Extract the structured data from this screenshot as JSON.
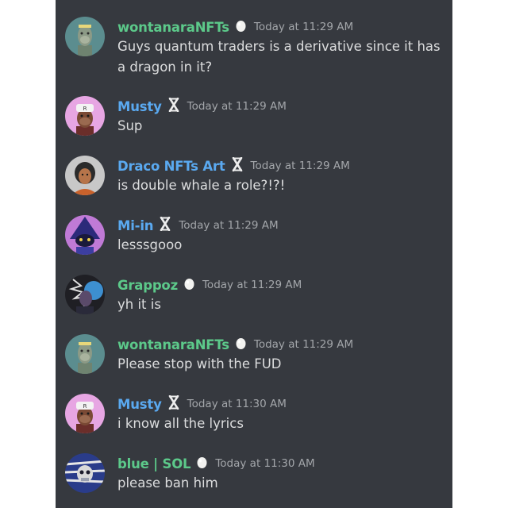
{
  "colors": {
    "background": "#36393f",
    "text": "#dcddde",
    "timestamp": "#a3a6aa",
    "username_green": "#5cc98a",
    "username_blue": "#5aa9f0"
  },
  "messages": [
    {
      "username": "wontanaraNFTs",
      "badge": "egg-badge",
      "timestamp": "Today at 11:29 AM",
      "text": "Guys quantum traders is a derivative since it has a dragon in it?"
    },
    {
      "username": "Musty",
      "badge": "x-badge",
      "timestamp": "Today at 11:29 AM",
      "text": "Sup"
    },
    {
      "username": "Draco NFTs Art",
      "badge": "x-badge",
      "timestamp": "Today at 11:29 AM",
      "text": "is double whale a role?!?!"
    },
    {
      "username": "Mi-in",
      "badge": "x-badge",
      "timestamp": "Today at 11:29 AM",
      "text": "lesssgooo"
    },
    {
      "username": "Grappoz",
      "badge": "egg-badge",
      "timestamp": "Today at 11:29 AM",
      "text": "yh it is"
    },
    {
      "username": "wontanaraNFTs",
      "badge": "egg-badge",
      "timestamp": "Today at 11:29 AM",
      "text": "Please stop with the FUD"
    },
    {
      "username": "Musty",
      "badge": "x-badge",
      "timestamp": "Today at 11:30 AM",
      "text": "i know all the lyrics"
    },
    {
      "username": "blue | SOL",
      "badge": "egg-badge",
      "timestamp": "Today at 11:30 AM",
      "text": "please ban him"
    }
  ]
}
